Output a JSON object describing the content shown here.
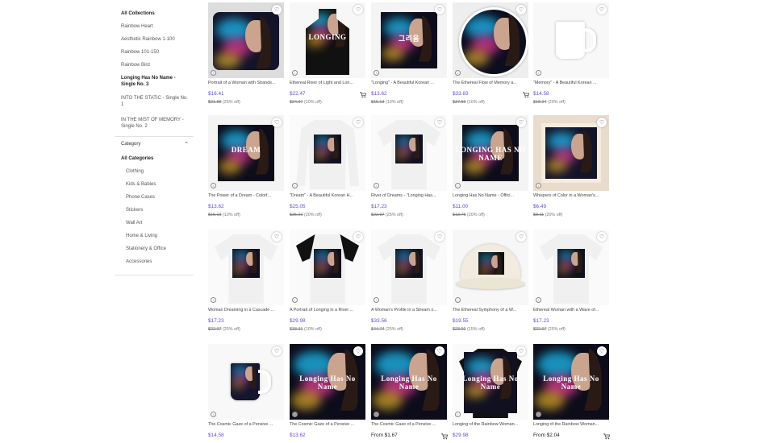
{
  "sidebar": {
    "collections": [
      {
        "label": "All Collections",
        "active": true
      },
      {
        "label": "Rainbow Heart"
      },
      {
        "label": "Aesthetic Rainbow 1-100"
      },
      {
        "label": "Rainbow 101-150"
      },
      {
        "label": "Rainbow Bird"
      },
      {
        "label": "Longing Has No Name -\nSingle No. 3",
        "active": true
      },
      {
        "label": "INTO THE STATIC - Single No.\n1"
      },
      {
        "label": "IN THE MIST OF MEMORY -\nSingle No. 2"
      }
    ],
    "category_title": "Category",
    "categories": [
      "All Categories",
      "Clothing",
      "Kids & Babies",
      "Phone Cases",
      "Stickers",
      "Wall Art",
      "Home & Living",
      "Stationery & Office",
      "Accessories"
    ]
  },
  "products": [
    {
      "title": "Portrait of a Woman with Strands...",
      "price": "$16.41",
      "orig": "$21.88",
      "off": "(25% off)",
      "kind": "pillow"
    },
    {
      "title": "Ethereal River of Light and Lon...",
      "price": "$22.47",
      "orig": "$24.97",
      "off": "(10% off)",
      "kind": "apron",
      "cart": true,
      "thumb_text": "LONGING"
    },
    {
      "title": "\"Longing\" - A Beautiful Korean ...",
      "price": "$13.62",
      "orig": "$15.13",
      "off": "(10% off)",
      "kind": "poster",
      "thumb_text": "그리움"
    },
    {
      "title": "The Ethereal Flow of Memory a...",
      "price": "$33.83",
      "orig": "$37.59",
      "off": "(10% off)",
      "kind": "clock",
      "cart": true
    },
    {
      "title": "\"Memory\" - A Beautiful Korean ...",
      "price": "$14.58",
      "orig": "$18.24",
      "off": "(20% off)",
      "kind": "mug"
    },
    {
      "title": "The Power of a Dream - Colorf...",
      "price": "$13.62",
      "orig": "$15.13",
      "off": "(10% off)",
      "kind": "poster",
      "thumb_text": "DREAM"
    },
    {
      "title": "\"Dream\" - A Beautiful Korean H...",
      "price": "$25.05",
      "orig": "$35.21",
      "off": "(20% off)",
      "kind": "longsleeve"
    },
    {
      "title": "River of Dreams - \"Longing Has...",
      "price": "$17.23",
      "orig": "$22.97",
      "off": "(25% off)",
      "kind": "tshirt"
    },
    {
      "title": "Longing Has No Name - Offici...",
      "price": "$11.00",
      "orig": "$13.75",
      "off": "(20% off)",
      "kind": "poster",
      "thumb_text": "LONGING HAS NO NAME"
    },
    {
      "title": "Whispers of Color in a Woman's...",
      "price": "$6.49",
      "orig": "$8.11",
      "off": "(20% off)",
      "kind": "framed"
    },
    {
      "title": "Woman Dreaming in a Cascade ...",
      "price": "$17.23",
      "orig": "$22.97",
      "off": "(25% off)",
      "kind": "tshirt"
    },
    {
      "title": "A Portrait of Longing in a River ...",
      "price": "$29.98",
      "orig": "$33.31",
      "off": "(10% off)",
      "kind": "raglan"
    },
    {
      "title": "A Woman's Profile in a Stream o...",
      "price": "$33.56",
      "orig": "$44.74",
      "off": "(25% off)",
      "kind": "tshirt"
    },
    {
      "title": "The Ethereal Symphony of a W...",
      "price": "$19.55",
      "orig": "$23.00",
      "off": "(15% off)",
      "kind": "cap"
    },
    {
      "title": "Ethereal Woman with a Wave of...",
      "price": "$17.23",
      "orig": "$22.97",
      "off": "(25% off)",
      "kind": "tshirt"
    },
    {
      "title": "The Cosmic Gaze of a Pensive ...",
      "price": "$14.58",
      "orig": "",
      "off": "",
      "kind": "mug2"
    },
    {
      "title": "The Cosmic Gaze of a Pensive ...",
      "price": "$13.62",
      "orig": "",
      "off": "",
      "kind": "album",
      "thumb_text": "Longing Has No Name"
    },
    {
      "title": "The Cosmic Gaze of a Pensive ...",
      "price": "From $1.67",
      "orig": "",
      "off": "",
      "kind": "album",
      "cart": true,
      "from": true,
      "thumb_text": "Longing Has No Name"
    },
    {
      "title": "Longing of the Rainbow Woman...",
      "price": "$29.98",
      "orig": "",
      "off": "",
      "kind": "allover",
      "thumb_text": "Longing Has No Name"
    },
    {
      "title": "Longing of the Rainbow Woman...",
      "price": "From $2.04",
      "orig": "",
      "off": "",
      "kind": "album",
      "cart": true,
      "from": true,
      "thumb_text": "Longing Has No Name"
    }
  ],
  "icons": {
    "favorite": "heart-icon",
    "cart": "cart-icon",
    "info": "info-icon",
    "collapse": "chevron-up-icon"
  },
  "colors": {
    "price": "#5a4fd1",
    "text": "#222222"
  }
}
